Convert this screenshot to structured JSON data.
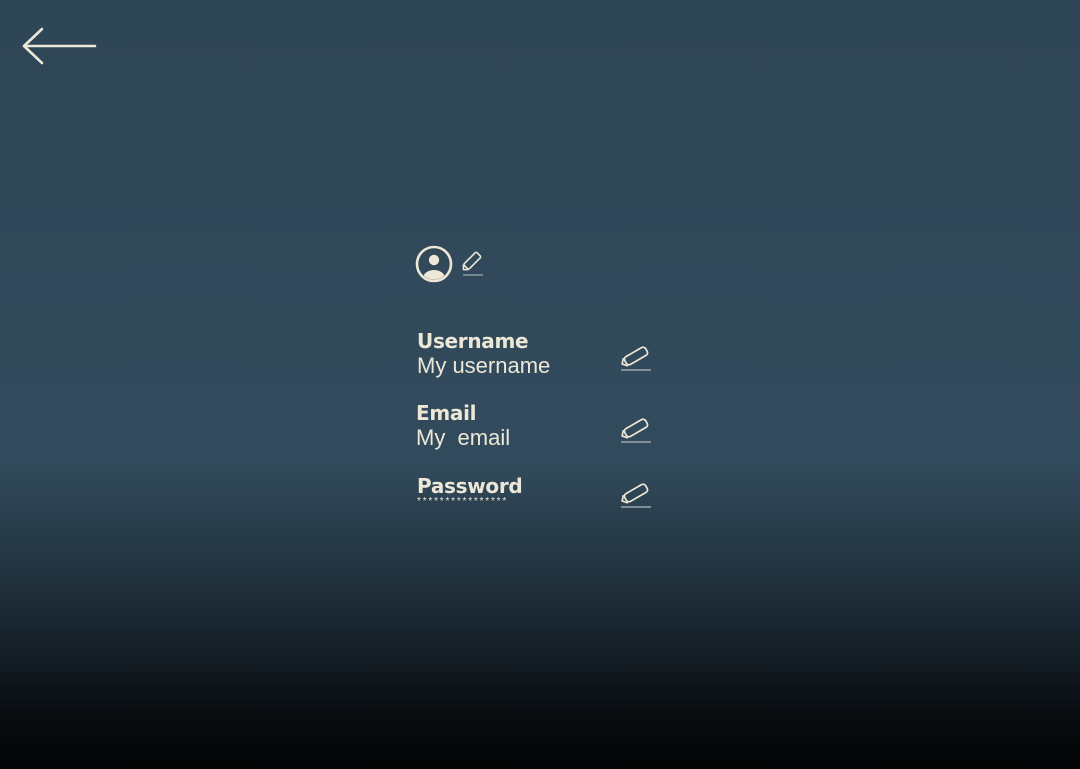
{
  "nav": {
    "back_icon": "arrow-left-icon"
  },
  "profile": {
    "avatar_icon": "user-circle-icon",
    "edit_icon": "pencil-icon"
  },
  "fields": {
    "username": {
      "label": "Username",
      "value": "My username"
    },
    "email": {
      "label": "Email",
      "value": "My  email"
    },
    "password": {
      "label": "Password",
      "value": "****************"
    }
  },
  "colors": {
    "text": "#ece7d6",
    "background_top": "#2f4656",
    "background_bottom": "#020304"
  }
}
